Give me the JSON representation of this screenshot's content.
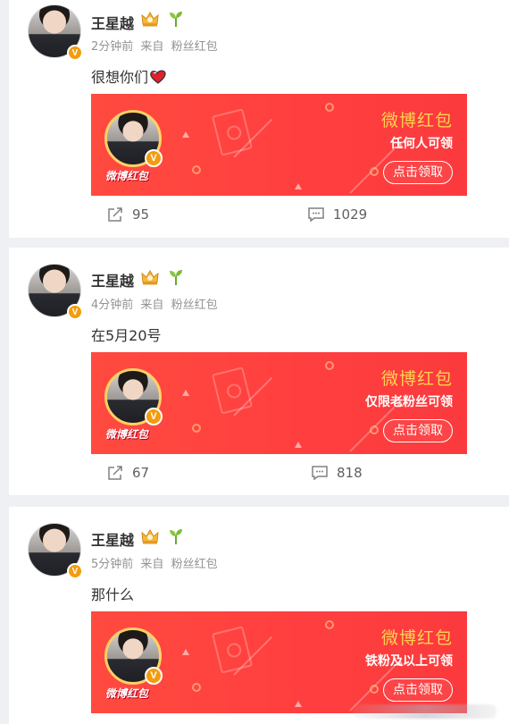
{
  "posts": [
    {
      "username": "王星越",
      "time": "2分钟前",
      "source_prefix": "来自",
      "source": "粉丝红包",
      "text": "很想你们",
      "has_heart": true,
      "card": {
        "title": "微博红包",
        "subtitle": "任何人可领",
        "button": "点击领取",
        "brand": "微博红包"
      },
      "reposts": "95",
      "comments": "1029"
    },
    {
      "username": "王星越",
      "time": "4分钟前",
      "source_prefix": "来自",
      "source": "粉丝红包",
      "text": "在5月20号",
      "has_heart": false,
      "card": {
        "title": "微博红包",
        "subtitle": "仅限老粉丝可领",
        "button": "点击领取",
        "brand": "微博红包"
      },
      "reposts": "67",
      "comments": "818"
    },
    {
      "username": "王星越",
      "time": "5分钟前",
      "source_prefix": "来自",
      "source": "粉丝红包",
      "text": "那什么",
      "has_heart": false,
      "card": {
        "title": "微博红包",
        "subtitle": "铁粉及以上可领",
        "button": "点击领取",
        "brand": "微博红包"
      }
    }
  ],
  "icons": {
    "verified": "V",
    "badge_crown": "crown-icon",
    "badge_sprout": "sprout-icon",
    "share": "share-icon",
    "comment": "comment-icon",
    "heart": "heart-icon"
  },
  "colors": {
    "card_red": "#ff4040",
    "card_gold": "#ffd34f",
    "verified_orange": "#f39c0e",
    "page_bg": "#eef0f3"
  }
}
